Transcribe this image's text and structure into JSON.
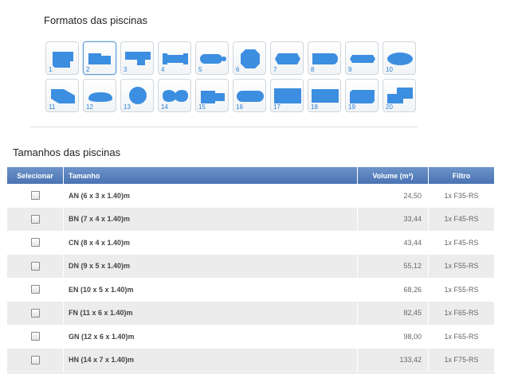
{
  "formats": {
    "title": "Formatos das piscinas",
    "shape_color": "#3c8ee0",
    "shapes": [
      {
        "number": "1"
      },
      {
        "number": "2",
        "selected": true
      },
      {
        "number": "3"
      },
      {
        "number": "4"
      },
      {
        "number": "5"
      },
      {
        "number": "6"
      },
      {
        "number": "7"
      },
      {
        "number": "8"
      },
      {
        "number": "9"
      },
      {
        "number": "10"
      },
      {
        "number": "11"
      },
      {
        "number": "12"
      },
      {
        "number": "13"
      },
      {
        "number": "14"
      },
      {
        "number": "15"
      },
      {
        "number": "16"
      },
      {
        "number": "17"
      },
      {
        "number": "18"
      },
      {
        "number": "19"
      },
      {
        "number": "20"
      }
    ]
  },
  "sizes": {
    "title": "Tamanhos das piscinas",
    "header_color": "#5a82bf",
    "headers": {
      "select": "Selecionar",
      "size": "Tamanho",
      "volume": "Volume (m³)",
      "filter": "Filtro"
    },
    "rows": [
      {
        "size": "AN (6 x 3 x 1.40)m",
        "volume": "24,50",
        "filter": "1x F35-RS"
      },
      {
        "size": "BN (7 x 4 x 1.40)m",
        "volume": "33,44",
        "filter": "1x F45-RS"
      },
      {
        "size": "CN (8 x 4 x 1.40)m",
        "volume": "43,44",
        "filter": "1x F45-RS"
      },
      {
        "size": "DN (9 x 5 x 1.40)m",
        "volume": "55,12",
        "filter": "1x F55-RS"
      },
      {
        "size": "EN (10 x 5 x 1.40)m",
        "volume": "68,26",
        "filter": "1x F55-RS"
      },
      {
        "size": "FN (11 x 6 x 1.40)m",
        "volume": "82,45",
        "filter": "1x F65-RS"
      },
      {
        "size": "GN (12 x 6 x 1.40)m",
        "volume": "98,00",
        "filter": "1x F65-RS"
      },
      {
        "size": "HN (14 x 7 x 1.40)m",
        "volume": "133,42",
        "filter": "1x F75-RS"
      }
    ]
  }
}
